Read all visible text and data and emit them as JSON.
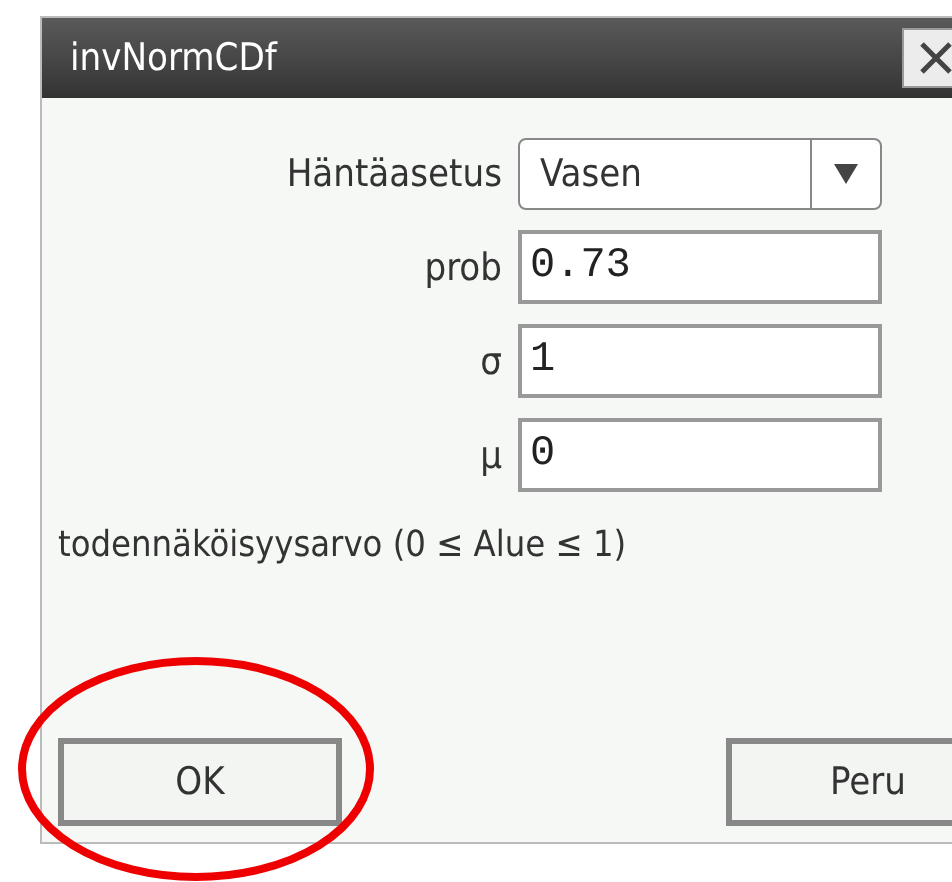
{
  "window": {
    "title": "invNormCDf"
  },
  "fields": [
    {
      "kind": "dropdown",
      "label": "Häntäasetus",
      "value": "Vasen"
    },
    {
      "kind": "input",
      "label": "prob",
      "value": "0.73"
    },
    {
      "kind": "input",
      "label": "σ",
      "value": "1"
    },
    {
      "kind": "input",
      "label": "μ",
      "value": "0"
    }
  ],
  "hint": "todennäköisyysarvo (0 ≤ Alue ≤ 1)",
  "buttons": [
    {
      "label": "OK"
    },
    {
      "label": "Peru"
    }
  ],
  "annotation": {
    "kind": "ellipse"
  }
}
